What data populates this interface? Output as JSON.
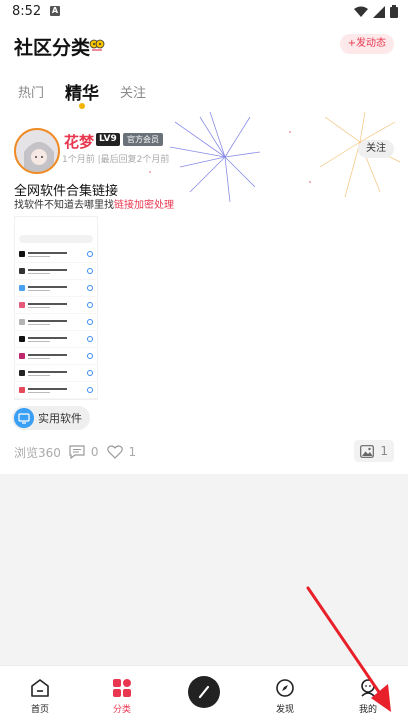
{
  "status": {
    "time": "8:52"
  },
  "header": {
    "title": "社区分类",
    "post_label": "+发动态"
  },
  "tabs": [
    {
      "label": "热门"
    },
    {
      "label": "精华"
    },
    {
      "label": "关注"
    }
  ],
  "post": {
    "username": "花梦",
    "level": "LV9",
    "role": "官方会员",
    "meta": "1个月前 |最后回复2个月前",
    "follow_label": "关注",
    "title": "全网软件合集链接",
    "subtitle_prefix": "找软件不知道去哪里找",
    "subtitle_highlight": "链接加密处理",
    "tag": "实用软件",
    "views": "浏览360",
    "comments": "0",
    "likes": "1",
    "images": "1"
  },
  "nav": [
    {
      "label": "首页"
    },
    {
      "label": "分类"
    },
    {
      "label": "发现"
    },
    {
      "label": "我的"
    }
  ],
  "colors": {
    "accent": "#e8374f",
    "tab_dot": "#f5b400"
  }
}
